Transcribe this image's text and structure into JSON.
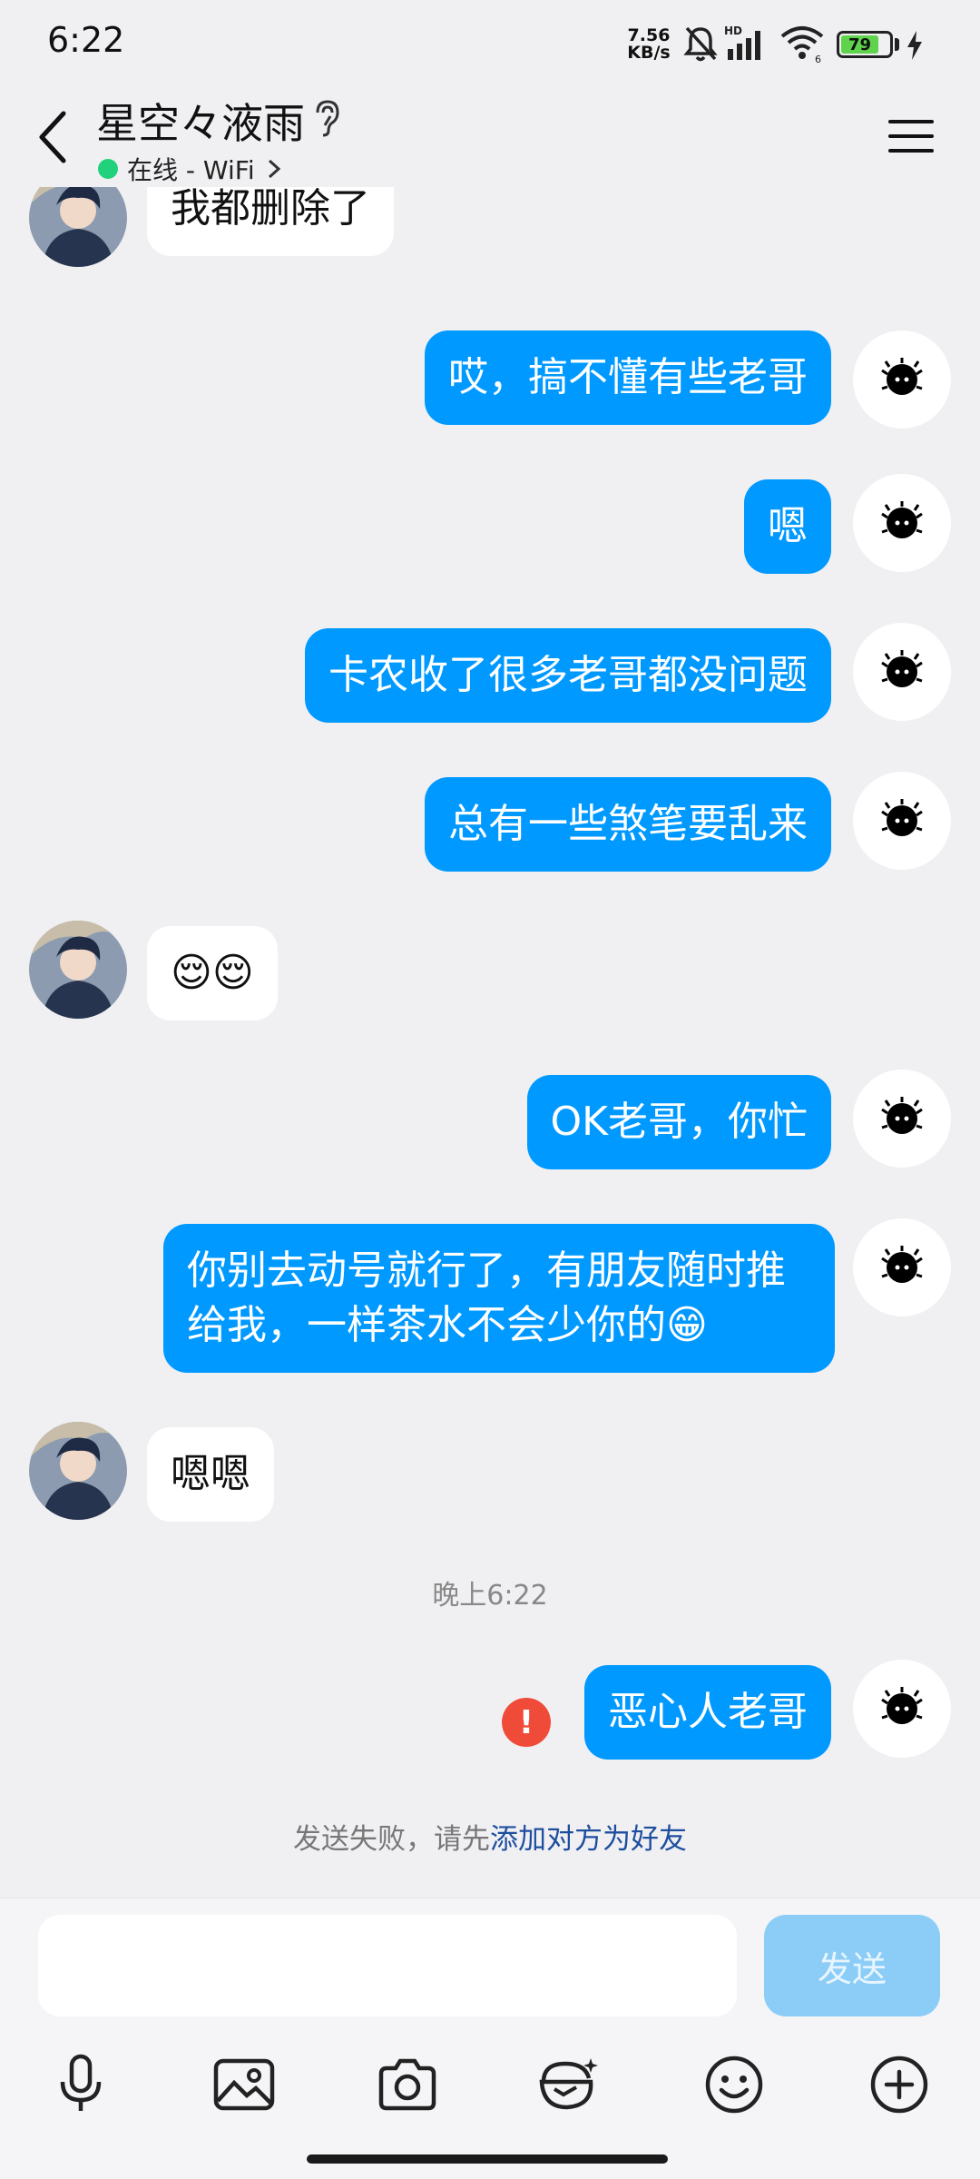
{
  "status_bar": {
    "time": "6:22",
    "net_speed_value": "7.56",
    "net_speed_unit": "KB/s",
    "battery_level": "79",
    "battery_color": "#5ed34b"
  },
  "header": {
    "contact_name": "星空々液雨",
    "status_text": "在线 - WiFi",
    "status_color": "#22d17c"
  },
  "messages": [
    {
      "side": "in",
      "text": "我都删除了"
    },
    {
      "side": "out",
      "text": "哎，搞不懂有些老哥"
    },
    {
      "side": "out",
      "text": "嗯"
    },
    {
      "side": "out",
      "text": "卡农收了很多老哥都没问题"
    },
    {
      "side": "out",
      "text": "总有一些煞笔要乱来"
    },
    {
      "side": "in",
      "text": "😌😌"
    },
    {
      "side": "out",
      "text": "OK老哥，你忙"
    },
    {
      "side": "out",
      "text": "你别去动号就行了，有朋友随时推给我，一样茶水不会少你的😁"
    },
    {
      "side": "in",
      "text": "嗯嗯"
    },
    {
      "side": "time",
      "text": "晚上6:22"
    },
    {
      "side": "out",
      "text": "恶心人老哥",
      "failed": true
    }
  ],
  "failure_notice": {
    "prefix": "发送失败，请先",
    "link": "添加对方为好友"
  },
  "input": {
    "placeholder": "",
    "send_label": "发送"
  },
  "toolbar_icons": [
    "microphone-icon",
    "image-icon",
    "camera-icon",
    "red-packet-icon",
    "emoji-icon",
    "plus-icon"
  ],
  "colors": {
    "outgoing_bubble": "#0099ff",
    "incoming_bubble": "#ffffff",
    "background": "#f0f0f3",
    "send_disabled": "#8ccdf7",
    "error": "#f04b38",
    "link": "#1e4e9e"
  }
}
